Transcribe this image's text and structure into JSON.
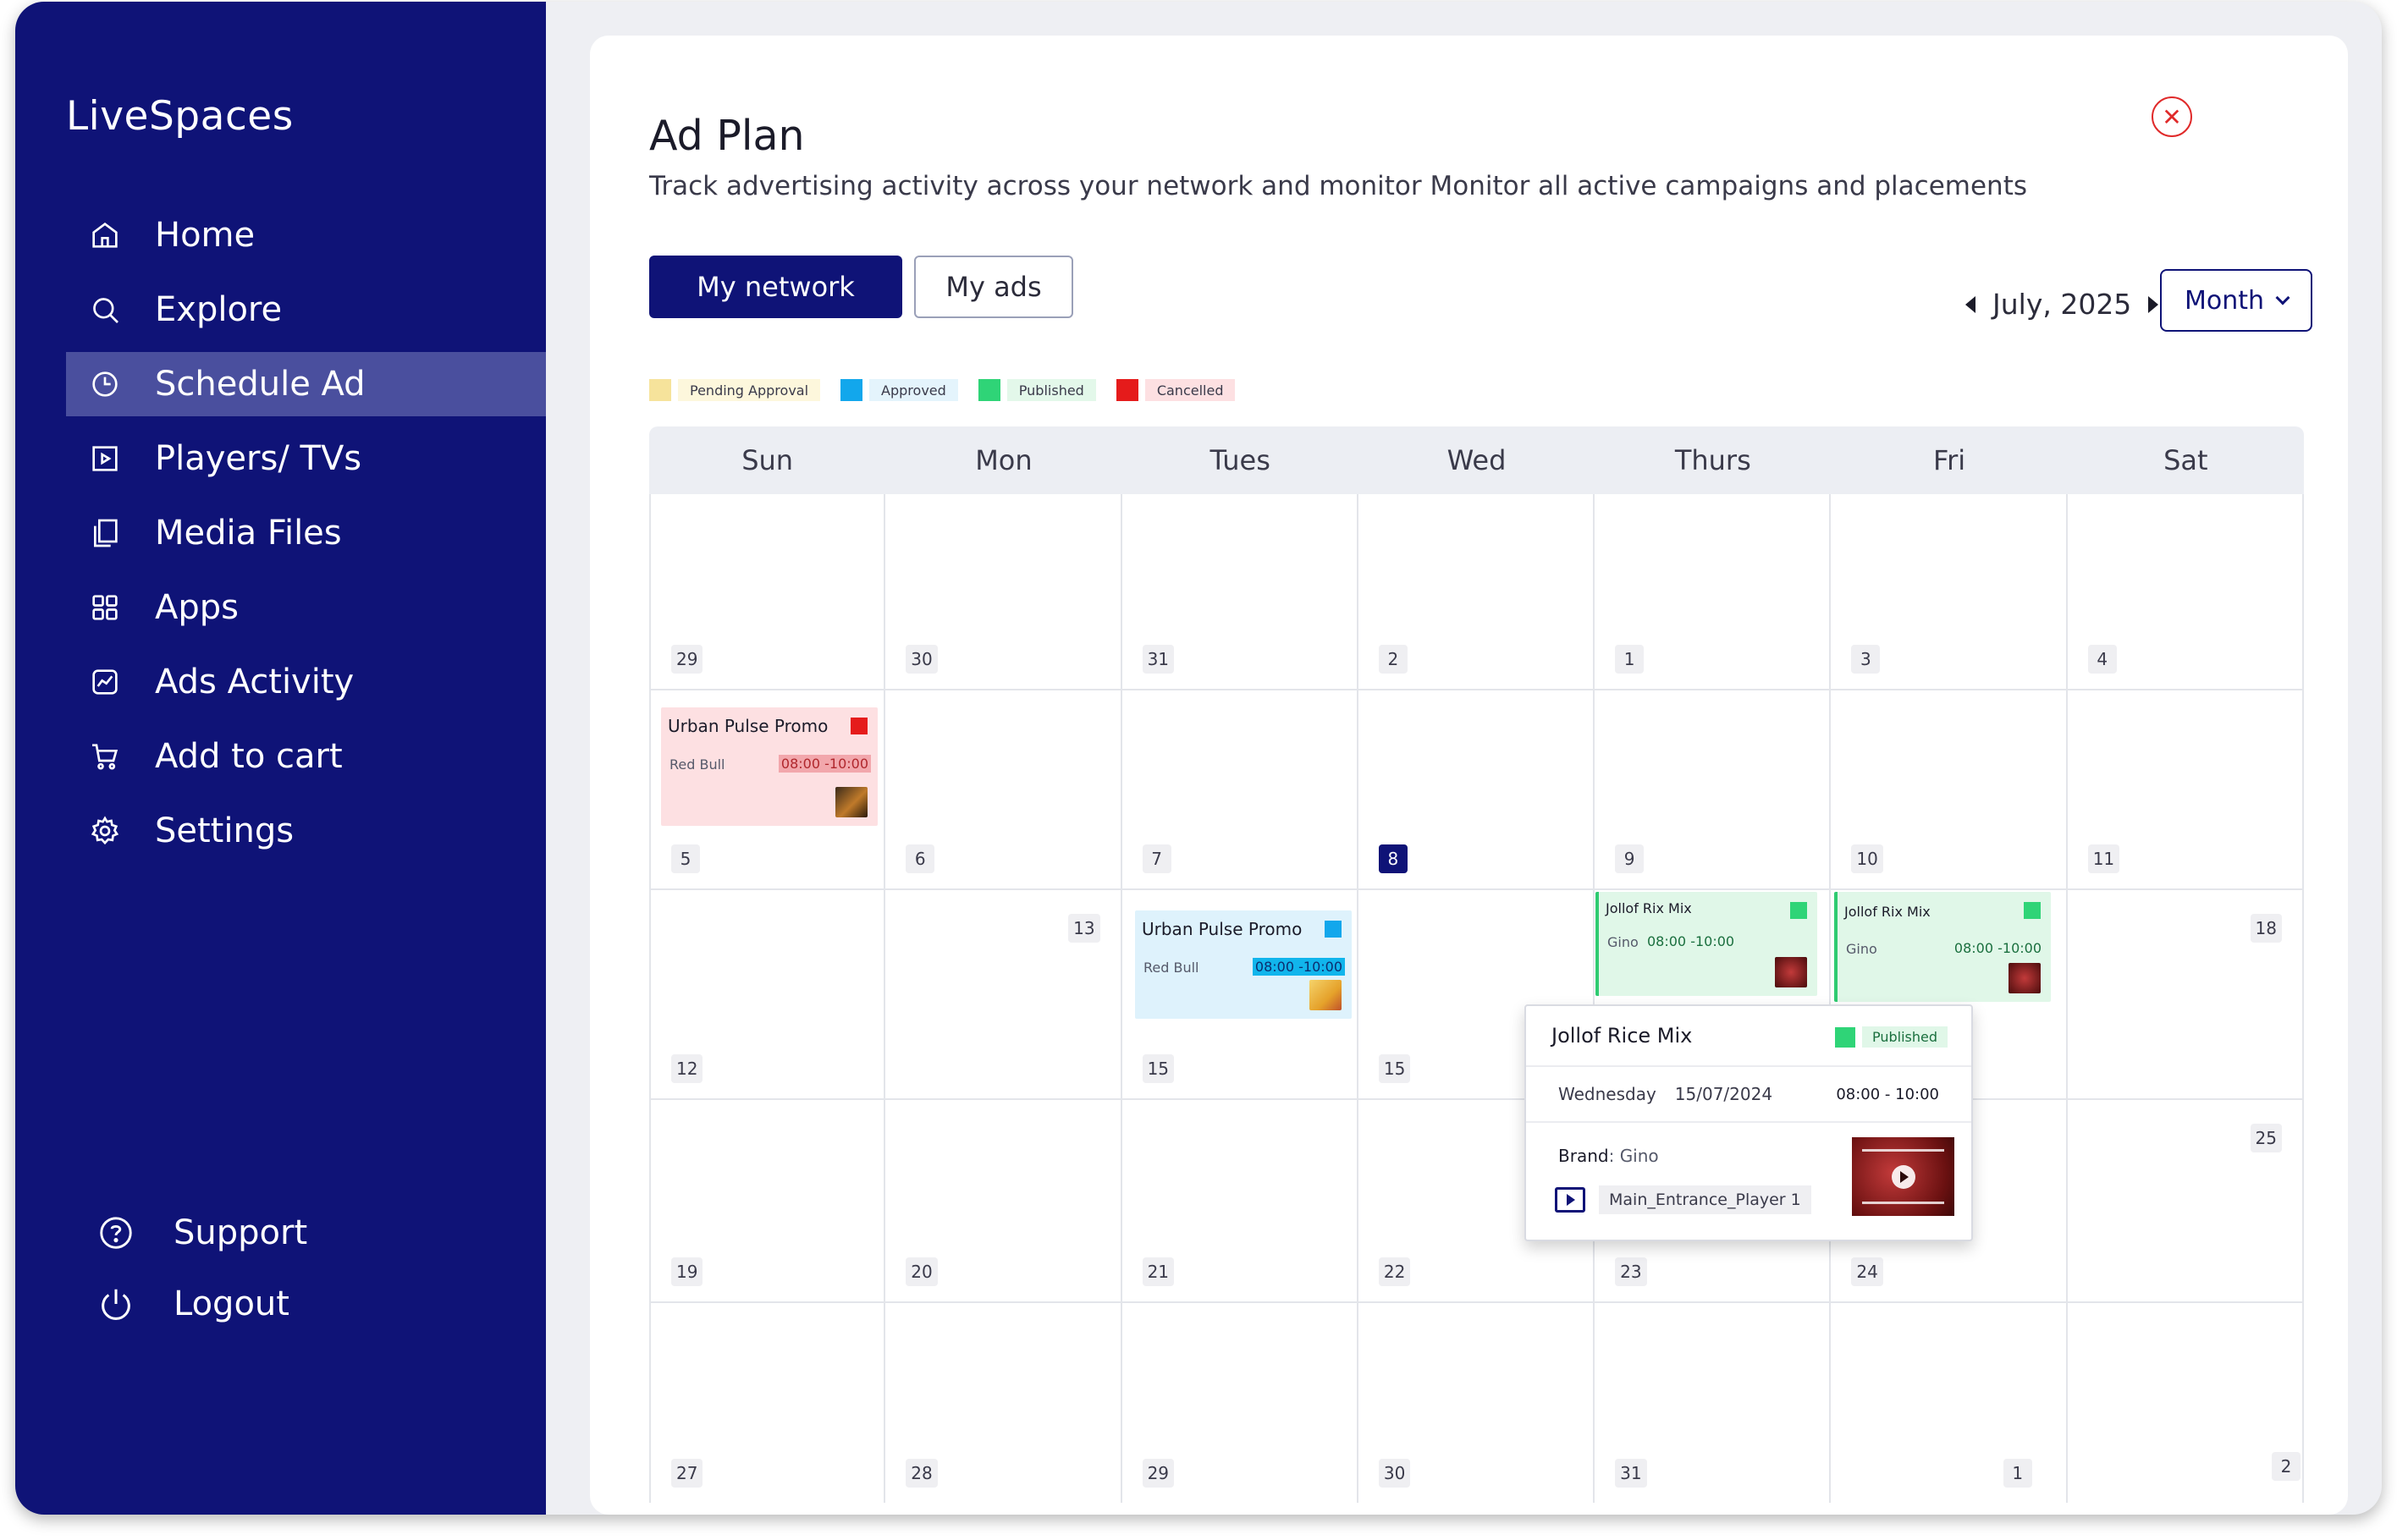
{
  "app": {
    "name": "LiveSpaces"
  },
  "sidebar": {
    "items": [
      {
        "label": "Home",
        "icon": "home-icon"
      },
      {
        "label": "Explore",
        "icon": "search-icon"
      },
      {
        "label": "Schedule Ad",
        "icon": "clock-icon",
        "active": true
      },
      {
        "label": "Players/ TVs",
        "icon": "play-square-icon"
      },
      {
        "label": "Media Files",
        "icon": "files-icon"
      },
      {
        "label": "Apps",
        "icon": "grid-icon"
      },
      {
        "label": "Ads Activity",
        "icon": "chart-icon"
      },
      {
        "label": "Add to cart",
        "icon": "cart-icon"
      },
      {
        "label": "Settings",
        "icon": "gear-icon"
      }
    ],
    "bottom": [
      {
        "label": "Support",
        "icon": "help-icon"
      },
      {
        "label": "Logout",
        "icon": "power-icon"
      }
    ]
  },
  "page": {
    "title": "Ad Plan",
    "subtitle": "Track advertising activity across your network and monitor Monitor all active campaigns and placements",
    "close_icon": "close-icon"
  },
  "toggle": {
    "primary": "My network",
    "secondary": "My ads"
  },
  "month_nav": {
    "label": "July, 2025"
  },
  "view_select": {
    "value": "Month"
  },
  "legend": [
    {
      "label": "Pending Approval",
      "swatch": "#f6e39b",
      "bg": "#fdf7dc"
    },
    {
      "label": "Approved",
      "swatch": "#12a7ec",
      "bg": "#e4f4fc"
    },
    {
      "label": "Published",
      "swatch": "#2fd477",
      "bg": "#e3f8ea"
    },
    {
      "label": "Cancelled",
      "swatch": "#e51b1b",
      "bg": "#fde0e2"
    }
  ],
  "calendar": {
    "weekdays": [
      "Sun",
      "Mon",
      "Tues",
      "Wed",
      "Thurs",
      "Fri",
      "Sat"
    ],
    "weeks": [
      [
        "29",
        "30",
        "31",
        "2",
        "1",
        "3",
        "4"
      ],
      [
        "5",
        "6",
        "7",
        "8",
        "9",
        "10",
        "11"
      ],
      [
        "12",
        "13",
        "15",
        "15",
        "",
        "",
        "18"
      ],
      [
        "19",
        "20",
        "21",
        "22",
        "23",
        "24",
        "25"
      ],
      [
        "27",
        "28",
        "29",
        "30",
        "31",
        "1",
        "2"
      ]
    ],
    "today": "8"
  },
  "events": [
    {
      "title": "Urban Pulse Promo",
      "brand": "Red Bull",
      "time": "08:00 -10:00",
      "status": "Cancelled"
    },
    {
      "title": "Urban Pulse Promo",
      "brand": "Red Bull",
      "time": "08:00 -10:00",
      "status": "Approved"
    },
    {
      "title": "Jollof Rix Mix",
      "brand": "Gino",
      "time": "08:00 -10:00",
      "status": "Published"
    },
    {
      "title": "Jollof Rix Mix",
      "brand": "Gino",
      "time": "08:00 -10:00",
      "status": "Published"
    }
  ],
  "popover": {
    "title": "Jollof Rice Mix",
    "status": "Published",
    "day": "Wednesday",
    "date": "15/07/2024",
    "time": "08:00 - 10:00",
    "brand_label": "Brand",
    "brand": "Gino",
    "player": "Main_Entrance_Player 1"
  }
}
